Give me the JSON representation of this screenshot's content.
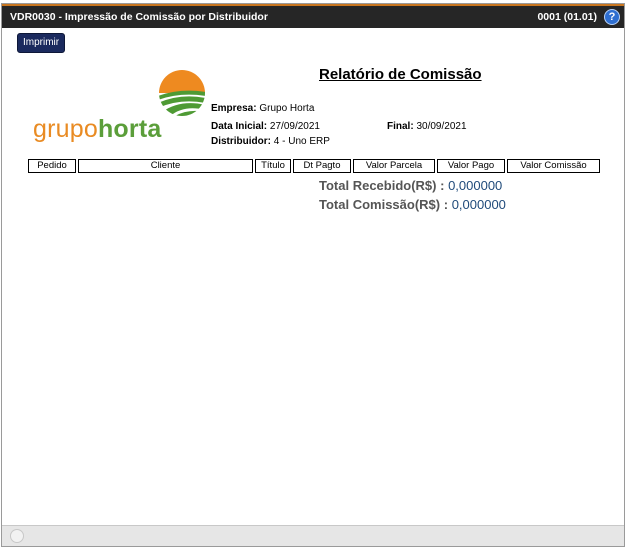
{
  "window": {
    "title": "VDR0030 - Impressão de Comissão por Distribuidor",
    "code": "0001 (01.01)",
    "help_glyph": "?"
  },
  "toolbar": {
    "print_label": "Imprimir"
  },
  "logo": {
    "text_part1": "grupo",
    "text_part2": "horta"
  },
  "report": {
    "title": "Relatório de Comissão",
    "empresa_label": "Empresa:",
    "empresa_value": "Grupo Horta",
    "data_inicial_label": "Data Inicial:",
    "data_inicial_value": "27/09/2021",
    "final_label": "Final:",
    "final_value": "30/09/2021",
    "distribuidor_label": "Distribuidor:",
    "distribuidor_value": "4 - Uno ERP"
  },
  "table": {
    "columns": [
      "Pedido",
      "Cliente",
      "Título",
      "Dt Pagto",
      "Valor Parcela",
      "Valor Pago",
      "Valor Comissão"
    ]
  },
  "totals": {
    "recebido_label": "Total Recebido(R$) :",
    "recebido_value": "0,000000",
    "comissao_label": "Total Comissão(R$) :",
    "comissao_value": "0,000000"
  },
  "colors": {
    "titlebar": "#262626",
    "accent_orange": "#e98b23",
    "brand_green": "#5b9e3a",
    "button_navy": "#1b2a5e",
    "value_blue": "#1f4a7a"
  }
}
